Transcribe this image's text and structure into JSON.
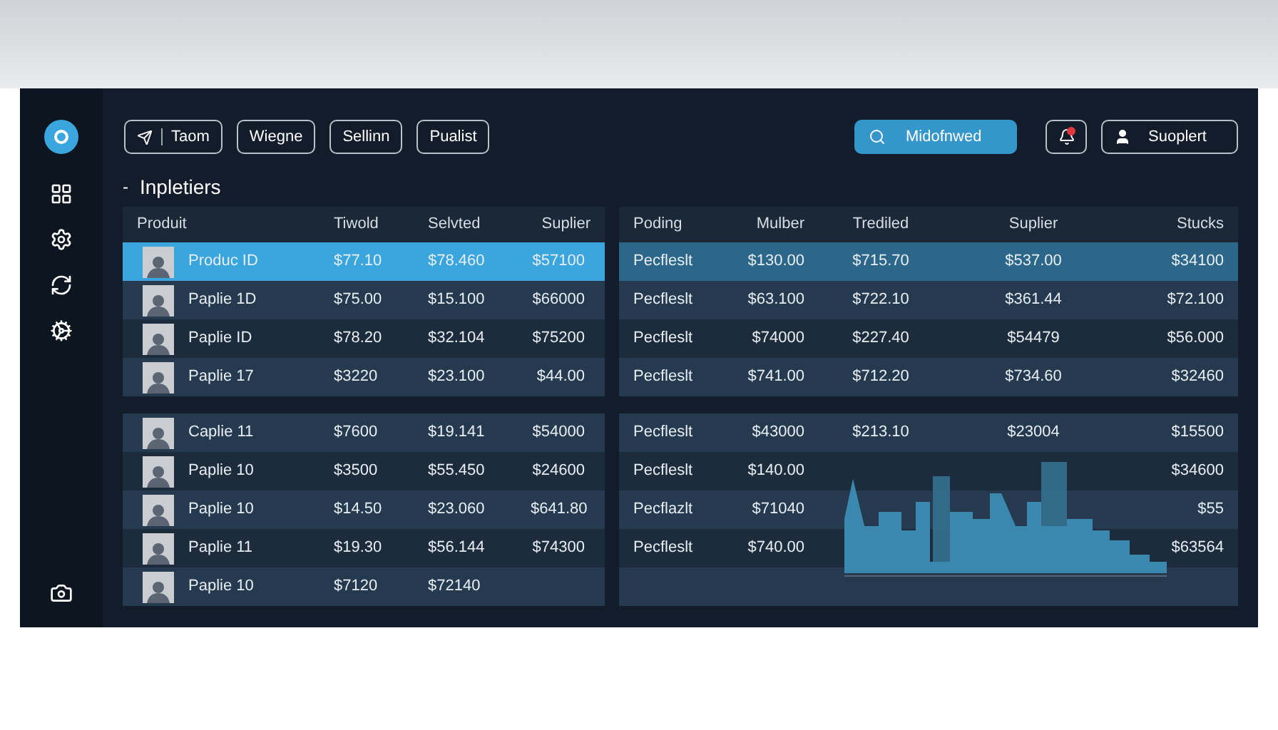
{
  "toolbar": {
    "buttons": [
      {
        "label": "Taom",
        "icon": true
      },
      {
        "label": "Wiegne",
        "icon": false
      },
      {
        "label": "Sellinn",
        "icon": false
      },
      {
        "label": "Pualist",
        "icon": false
      }
    ],
    "search": {
      "label": "Midofnwed"
    },
    "notifications": {
      "badge": true
    },
    "user": {
      "label": "Suoplert"
    }
  },
  "section": {
    "bullet": "-",
    "title": "Inpletiers"
  },
  "left_table": {
    "columns": [
      "Produit",
      "Tiwold",
      "Selvted",
      "Suplier"
    ],
    "groups": [
      [
        {
          "name": "Produc ID",
          "values": [
            "$77.10",
            "$78.460",
            "$57100"
          ],
          "selected": true
        },
        {
          "name": "Paplie 1D",
          "values": [
            "$75.00",
            "$15.100",
            "$66000"
          ],
          "selected": false
        },
        {
          "name": "Paplie ID",
          "values": [
            "$78.20",
            "$32.104",
            "$75200"
          ],
          "selected": false
        },
        {
          "name": "Paplie 17",
          "values": [
            "$3220",
            "$23.100",
            "$44.00"
          ],
          "selected": false
        }
      ],
      [
        {
          "name": "Caplie 11",
          "values": [
            "$7600",
            "$19.141",
            "$54000"
          ],
          "selected": false
        },
        {
          "name": "Paplie 10",
          "values": [
            "$3500",
            "$55.450",
            "$24600"
          ],
          "selected": false
        },
        {
          "name": "Paplie 10",
          "values": [
            "$14.50",
            "$23.060",
            "$641.80"
          ],
          "selected": false
        },
        {
          "name": "Paplie 11",
          "values": [
            "$19.30",
            "$56.144",
            "$74300"
          ],
          "selected": false
        },
        {
          "name": "Paplie 10",
          "values": [
            "$7120",
            "$72140"
          ],
          "selected": false
        }
      ]
    ]
  },
  "right_table": {
    "columns": [
      "Poding",
      "Mulber",
      "Trediled",
      "Suplier",
      "Stucks"
    ],
    "top_rows": [
      {
        "cells": [
          "Pecfleslt",
          "$130.00",
          "$715.70",
          "$537.00",
          "$34100"
        ],
        "selected": true
      },
      {
        "cells": [
          "Pecfleslt",
          "$63.100",
          "$722.10",
          "$361.44",
          "$72.100"
        ],
        "selected": false
      },
      {
        "cells": [
          "Pecfleslt",
          "$74000",
          "$227.40",
          "$54479",
          "$56.000"
        ],
        "selected": false
      },
      {
        "cells": [
          "Pecfleslt",
          "$741.00",
          "$712.20",
          "$734.60",
          "$32460"
        ],
        "selected": false
      }
    ],
    "bottom_rows": [
      {
        "product": "Pecfleslt",
        "number": "$43000",
        "traded": "$213.10",
        "supplier": "$23004",
        "stocks": "$15500"
      },
      {
        "product": "Pecfleslt",
        "number": "$140.00",
        "stocks": "$34600"
      },
      {
        "product": "Pecflazlt",
        "number": "$71040",
        "stocks": "$55"
      },
      {
        "product": "Pecfleslt",
        "number": "$740.00",
        "stocks": "$63564"
      }
    ]
  }
}
